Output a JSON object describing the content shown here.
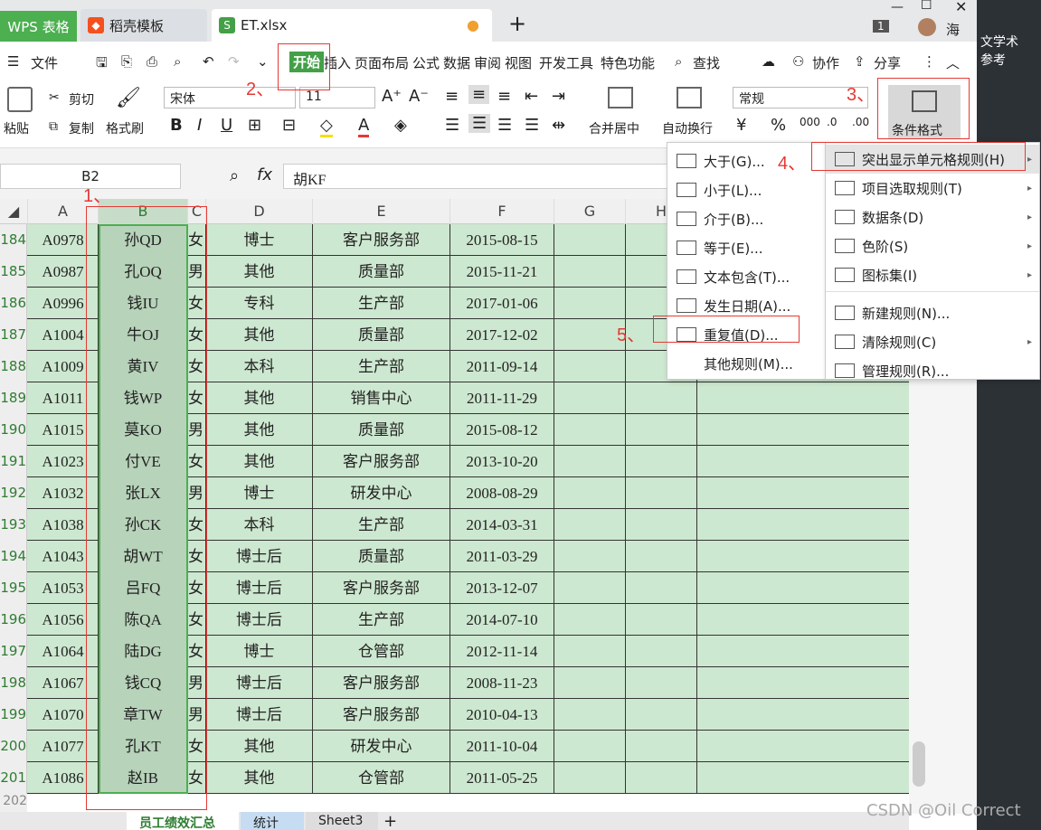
{
  "tabs": {
    "wps": "WPS 表格",
    "doc": "稻壳模板",
    "file": "ET.xlsx",
    "add": "+",
    "badge": "1",
    "user": "海"
  },
  "menu": {
    "file": "文件",
    "start": "开始",
    "insert": "插入",
    "layout": "页面布局",
    "formula": "公式",
    "data": "数据",
    "review": "审阅",
    "view": "视图",
    "dev": "开发工具",
    "special": "特色功能",
    "search": "查找",
    "cowork": "协作",
    "share": "分享"
  },
  "ribbon": {
    "paste": "粘贴",
    "cut": "剪切",
    "copy": "复制",
    "painter": "格式刷",
    "font": "宋体",
    "size": "11",
    "merge": "合并居中",
    "wrap": "自动换行",
    "numfmt": "常规",
    "cond": "条件格式"
  },
  "formula": {
    "namebox": "B2",
    "fx": "fx",
    "value": "胡KF"
  },
  "columns": [
    "A",
    "B",
    "C",
    "D",
    "E",
    "F",
    "G",
    "H"
  ],
  "rows": [
    {
      "n": "184",
      "a": "A0978",
      "b": "孙QD",
      "c": "女",
      "d": "博士",
      "e": "客户服务部",
      "f": "2015-08-15"
    },
    {
      "n": "185",
      "a": "A0987",
      "b": "孔OQ",
      "c": "男",
      "d": "其他",
      "e": "质量部",
      "f": "2015-11-21"
    },
    {
      "n": "186",
      "a": "A0996",
      "b": "钱IU",
      "c": "女",
      "d": "专科",
      "e": "生产部",
      "f": "2017-01-06"
    },
    {
      "n": "187",
      "a": "A1004",
      "b": "牛OJ",
      "c": "女",
      "d": "其他",
      "e": "质量部",
      "f": "2017-12-02"
    },
    {
      "n": "188",
      "a": "A1009",
      "b": "黄IV",
      "c": "女",
      "d": "本科",
      "e": "生产部",
      "f": "2011-09-14"
    },
    {
      "n": "189",
      "a": "A1011",
      "b": "钱WP",
      "c": "女",
      "d": "其他",
      "e": "销售中心",
      "f": "2011-11-29"
    },
    {
      "n": "190",
      "a": "A1015",
      "b": "莫KO",
      "c": "男",
      "d": "其他",
      "e": "质量部",
      "f": "2015-08-12"
    },
    {
      "n": "191",
      "a": "A1023",
      "b": "付VE",
      "c": "女",
      "d": "其他",
      "e": "客户服务部",
      "f": "2013-10-20"
    },
    {
      "n": "192",
      "a": "A1032",
      "b": "张LX",
      "c": "男",
      "d": "博士",
      "e": "研发中心",
      "f": "2008-08-29"
    },
    {
      "n": "193",
      "a": "A1038",
      "b": "孙CK",
      "c": "女",
      "d": "本科",
      "e": "生产部",
      "f": "2014-03-31"
    },
    {
      "n": "194",
      "a": "A1043",
      "b": "胡WT",
      "c": "女",
      "d": "博士后",
      "e": "质量部",
      "f": "2011-03-29"
    },
    {
      "n": "195",
      "a": "A1053",
      "b": "吕FQ",
      "c": "女",
      "d": "博士后",
      "e": "客户服务部",
      "f": "2013-12-07"
    },
    {
      "n": "196",
      "a": "A1056",
      "b": "陈QA",
      "c": "女",
      "d": "博士后",
      "e": "生产部",
      "f": "2014-07-10"
    },
    {
      "n": "197",
      "a": "A1064",
      "b": "陆DG",
      "c": "女",
      "d": "博士",
      "e": "仓管部",
      "f": "2012-11-14"
    },
    {
      "n": "198",
      "a": "A1067",
      "b": "钱CQ",
      "c": "男",
      "d": "博士后",
      "e": "客户服务部",
      "f": "2008-11-23"
    },
    {
      "n": "199",
      "a": "A1070",
      "b": "章TW",
      "c": "男",
      "d": "博士后",
      "e": "客户服务部",
      "f": "2010-04-13"
    },
    {
      "n": "200",
      "a": "A1077",
      "b": "孔KT",
      "c": "女",
      "d": "其他",
      "e": "研发中心",
      "f": "2011-10-04"
    },
    {
      "n": "201",
      "a": "A1086",
      "b": "赵IB",
      "c": "女",
      "d": "其他",
      "e": "仓管部",
      "f": "2011-05-25"
    }
  ],
  "lastrow": "202",
  "menu_left": [
    "大于(G)...",
    "小于(L)...",
    "介于(B)...",
    "等于(E)...",
    "文本包含(T)...",
    "发生日期(A)...",
    "重复值(D)...",
    "其他规则(M)..."
  ],
  "menu_right": [
    "突出显示单元格规则(H)",
    "项目选取规则(T)",
    "数据条(D)",
    "色阶(S)",
    "图标集(I)",
    "新建规则(N)...",
    "清除规则(C)",
    "管理规则(R)..."
  ],
  "annotations": [
    "1、",
    "2、",
    "3、",
    "4、",
    "5、"
  ],
  "sheets": [
    "员工绩效汇总",
    "统计",
    "Sheet3",
    "+"
  ],
  "side_text": [
    "文学术",
    "参考"
  ],
  "watermark": "CSDN @Oil Correct",
  "colors": {
    "accent": "#4caf50",
    "grid": "#cde8d0",
    "annotation": "#e53935"
  }
}
